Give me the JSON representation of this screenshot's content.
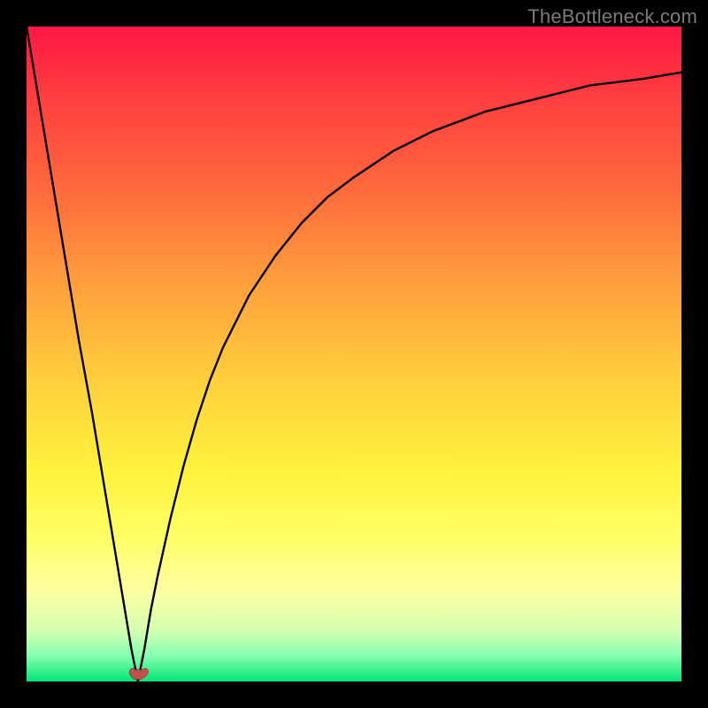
{
  "watermark": "TheBottleneck.com",
  "colors": {
    "frame": "#000000",
    "marker_fill": "#c4504e",
    "marker_stroke": "#7d2f2d",
    "curve_stroke": "#000000"
  },
  "chart_data": {
    "type": "line",
    "title": "",
    "xlabel": "",
    "ylabel": "",
    "xlim": [
      0,
      100
    ],
    "ylim": [
      0,
      100
    ],
    "grid": false,
    "legend": false,
    "background": "gradient red→green (top→bottom)",
    "curve_description": "V-shaped curve dropping from top-left to a minimum near x≈17 then rising asymptotically toward top-right",
    "series": [
      {
        "name": "bottleneck-curve",
        "x": [
          0,
          2,
          4,
          6,
          8,
          10,
          12,
          14,
          15,
          16,
          17,
          18,
          19,
          20,
          22,
          24,
          26,
          28,
          30,
          34,
          38,
          42,
          46,
          50,
          56,
          62,
          70,
          78,
          86,
          94,
          100
        ],
        "values": [
          100,
          88,
          76,
          64,
          52,
          41,
          29,
          17,
          11,
          5,
          0,
          5,
          11,
          16,
          25,
          33,
          40,
          46,
          51,
          59,
          65,
          70,
          74,
          77,
          81,
          84,
          87,
          89,
          91,
          92,
          93
        ]
      }
    ],
    "marker": {
      "x": 17,
      "y": 1.2,
      "shape": "heart"
    }
  }
}
